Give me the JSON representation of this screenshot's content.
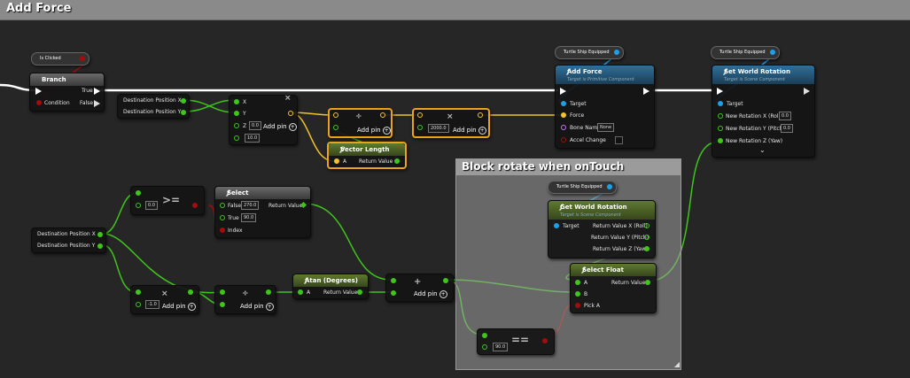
{
  "graph": {
    "comment_title": "Add Force",
    "sub_comment_title": "Block rotate when onTouch"
  },
  "vars": {
    "is_clicked": "Is Clicked",
    "turtle_ship": "Turtle Ship Equipped",
    "dest_x": "Destination Position X",
    "dest_y": "Destination Position Y"
  },
  "branch": {
    "title": "Branch",
    "true_label": "True",
    "false_label": "False",
    "condition_label": "Condition"
  },
  "make_vec": {
    "x_label": "X",
    "y_label": "Y",
    "z_label": "Z",
    "z_value": "0.0",
    "extra_value": "10.0",
    "add_pin": "Add pin"
  },
  "divide1": {
    "op": "÷",
    "add_pin": "Add pin"
  },
  "mult1": {
    "op": "×",
    "value": "2000.0",
    "add_pin": "Add pin"
  },
  "vec_length": {
    "title": "Vector Length",
    "a_label": "A",
    "ret_label": "Return Value"
  },
  "add_force": {
    "title": "Add Force",
    "subtitle": "Target is Primitive Component",
    "target": "Target",
    "force": "Force",
    "bone_name": "Bone Name",
    "bone_value": "None",
    "accel_change": "Accel Change"
  },
  "set_rot": {
    "title": "Set World Rotation",
    "subtitle": "Target is Scene Component",
    "target": "Target",
    "x": "New Rotation X (Roll)",
    "y": "New Rotation Y (Pitch)",
    "z": "New Rotation Z (Yaw)",
    "x_val": "0.0",
    "y_val": "0.0"
  },
  "gte": {
    "op": ">=",
    "value": "0.0"
  },
  "select": {
    "title": "Select",
    "false_label": "False",
    "false_val": "270.0",
    "true_label": "True",
    "true_val": "90.0",
    "index_label": "Index",
    "ret_label": "Return Value"
  },
  "mult2": {
    "op": "×",
    "value": "-1.0",
    "add_pin": "Add pin"
  },
  "divide2": {
    "op": "÷",
    "add_pin": "Add pin"
  },
  "atan": {
    "title": "Atan (Degrees)",
    "a_label": "A",
    "ret_label": "Return Value"
  },
  "add": {
    "op": "+",
    "add_pin": "Add pin"
  },
  "get_rot": {
    "title": "Get World Rotation",
    "subtitle": "Target is Scene Component",
    "target": "Target",
    "x": "Return Value X (Roll)",
    "y": "Return Value Y (Pitch)",
    "z": "Return Value Z (Yaw)"
  },
  "select_float": {
    "title": "Select Float",
    "a_label": "A",
    "b_label": "B",
    "pick_label": "Pick A",
    "ret_label": "Return Value"
  },
  "eq": {
    "op": "==",
    "value": "90.0"
  },
  "colors": {
    "float": "#3fc51c",
    "vector": "#f2c32a",
    "bool": "#a30d0d",
    "object": "#1f9fe8",
    "exec": "#ffffff",
    "name": "#c876ff"
  }
}
